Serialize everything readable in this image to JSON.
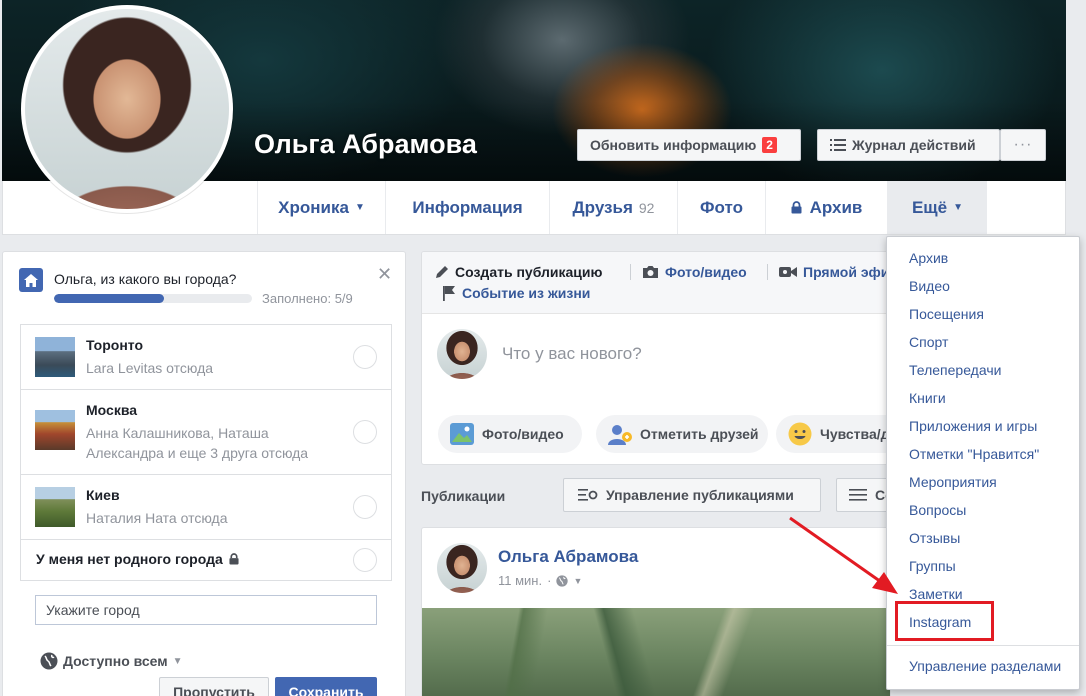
{
  "profile": {
    "name": "Ольга Абрамова",
    "update_info_label": "Обновить информацию",
    "update_info_badge": "2",
    "activity_log_label": "Журнал действий",
    "more_dots": "···"
  },
  "nav": {
    "tabs": [
      {
        "label": "Хроника",
        "caret": "▼"
      },
      {
        "label": "Информация"
      },
      {
        "label": "Друзья",
        "count": "92"
      },
      {
        "label": "Фото"
      },
      {
        "label": "Архив"
      },
      {
        "label": "Ещё",
        "caret": "▼"
      }
    ]
  },
  "city_prompt": {
    "question": "Ольга, из какого вы города?",
    "progress_text": "Заполнено: 5/9",
    "progress_fraction": 0.5556,
    "close": "✕",
    "cities": [
      {
        "name": "Торонто",
        "sub": "Lara Levitas отсюда"
      },
      {
        "name": "Москва",
        "sub": "Анна Калашникова, Наташа Александра и еще 3 друга отсюда"
      },
      {
        "name": "Киев",
        "sub": "Наталия Ната отсюда"
      }
    ],
    "no_home": "У меня нет родного города",
    "input_placeholder": "Укажите город",
    "privacy": "Доступно всем",
    "skip_label": "Пропустить",
    "save_label": "Сохранить"
  },
  "composer": {
    "tab_create": "Создать публикацию",
    "tab_photo": "Фото/видео",
    "tab_live": "Прямой эфир",
    "tab_event": "Событие из жизни",
    "placeholder": "Что у вас нового?",
    "pill_photo": "Фото/видео",
    "pill_tag": "Отметить друзей",
    "pill_feeling": "Чувства/действия"
  },
  "publications": {
    "label": "Публикации",
    "manage_label": "Управление публикациями",
    "view_label": "Сетка"
  },
  "post": {
    "author": "Ольга Абрамова",
    "time": "11 мин."
  },
  "dropdown": {
    "items": [
      "Архив",
      "Видео",
      "Посещения",
      "Спорт",
      "Телепередачи",
      "Книги",
      "Приложения и игры",
      "Отметки \"Нравится\"",
      "Мероприятия",
      "Вопросы",
      "Отзывы",
      "Группы",
      "Заметки",
      "Instagram"
    ],
    "manage_sections": "Управление разделами"
  },
  "colors": {
    "fb_blue": "#4267b2",
    "link_blue": "#365899",
    "highlight_red": "#e21b23"
  }
}
